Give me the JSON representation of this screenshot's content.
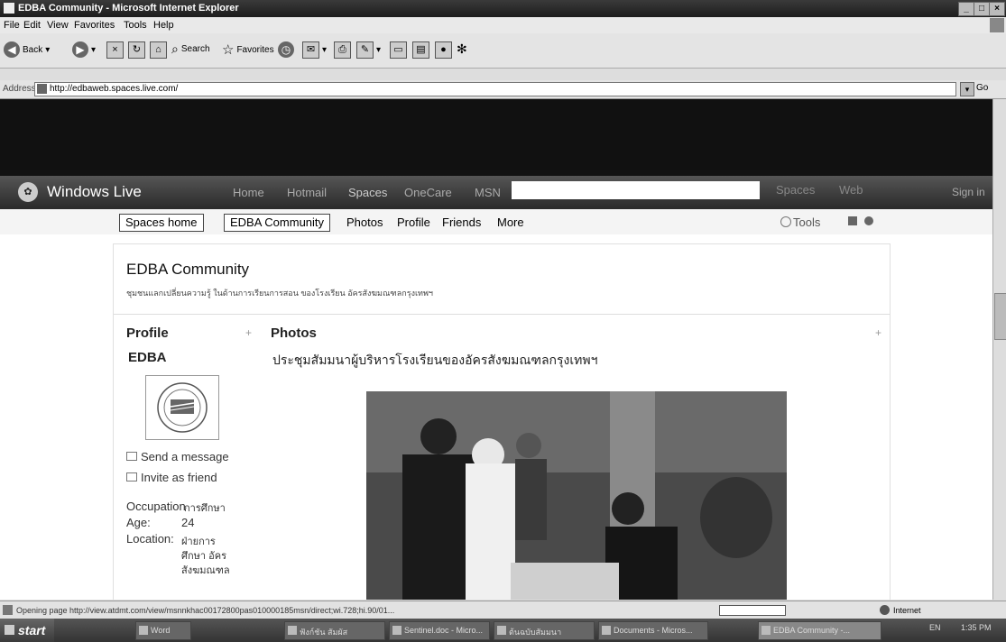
{
  "window": {
    "title": "EDBA Community - Microsoft Internet Explorer"
  },
  "menu": [
    "File",
    "Edit",
    "View",
    "Favorites",
    "Tools",
    "Help"
  ],
  "toolbar": {
    "back": "Back",
    "search": "Search",
    "favorites": "Favorites"
  },
  "address": {
    "label": "Address",
    "url": "http://edbaweb.spaces.live.com/",
    "go": "Go"
  },
  "wl_header": {
    "brand": "Windows Live",
    "nav": [
      "Home",
      "Hotmail",
      "Spaces",
      "OneCare",
      "MSN"
    ],
    "search_buttons": [
      "Spaces",
      "Web"
    ],
    "signin": "Sign in"
  },
  "tabs": {
    "spaces_home": "Spaces home",
    "community": "EDBA Community",
    "items": [
      "Photos",
      "Profile",
      "Friends",
      "More"
    ],
    "tools": "Tools"
  },
  "space": {
    "title": "EDBA Community",
    "subtitle": "ชุมชนแลกเปลี่ยนความรู้ ในด้านการเรียนการสอน ของโรงเรียน อัครสังฆมณฑลกรุงเทพฯ"
  },
  "profile": {
    "heading": "Profile",
    "name": "EDBA",
    "send_message": "Send a message",
    "invite": "Invite as friend",
    "occupation_label": "Occupation",
    "occupation_value": "การศึกษา",
    "age_label": "Age:",
    "age_value": "24",
    "location_label": "Location:",
    "location_lines": [
      "ฝ่ายการ",
      "ศึกษา อัคร",
      "สังฆมณฑล"
    ]
  },
  "photos": {
    "heading": "Photos",
    "album_title": "ประชุมสัมมนาผู้บริหารโรงเรียนของอัครสังฆมณฑลกรุงเทพฯ"
  },
  "status": {
    "text": "Opening page http://view.atdmt.com/view/msnnkhac00172800pas010000185msn/direct;wi.728;hi.90/01...",
    "zone": "Internet"
  },
  "taskbar": {
    "start": "start",
    "tasks": [
      "Word",
      "ฟังก์ชัน สัมผัส",
      "Sentinel.doc - Micro...",
      "ต้นฉบับสัมมนา",
      "Documents - Micros...",
      "EDBA Community -..."
    ],
    "lang": "EN",
    "clock": "1:35 PM"
  },
  "colors": {
    "banner": "#111111",
    "header_bar": "#3a3a3a"
  },
  "icons": [
    "back-icon",
    "forward-icon",
    "stop-icon",
    "refresh-icon",
    "home-icon",
    "search-icon",
    "favorites-star-icon",
    "history-icon",
    "mail-icon",
    "print-icon",
    "windows-live-logo-icon",
    "tools-gear-icon",
    "help-icon"
  ]
}
